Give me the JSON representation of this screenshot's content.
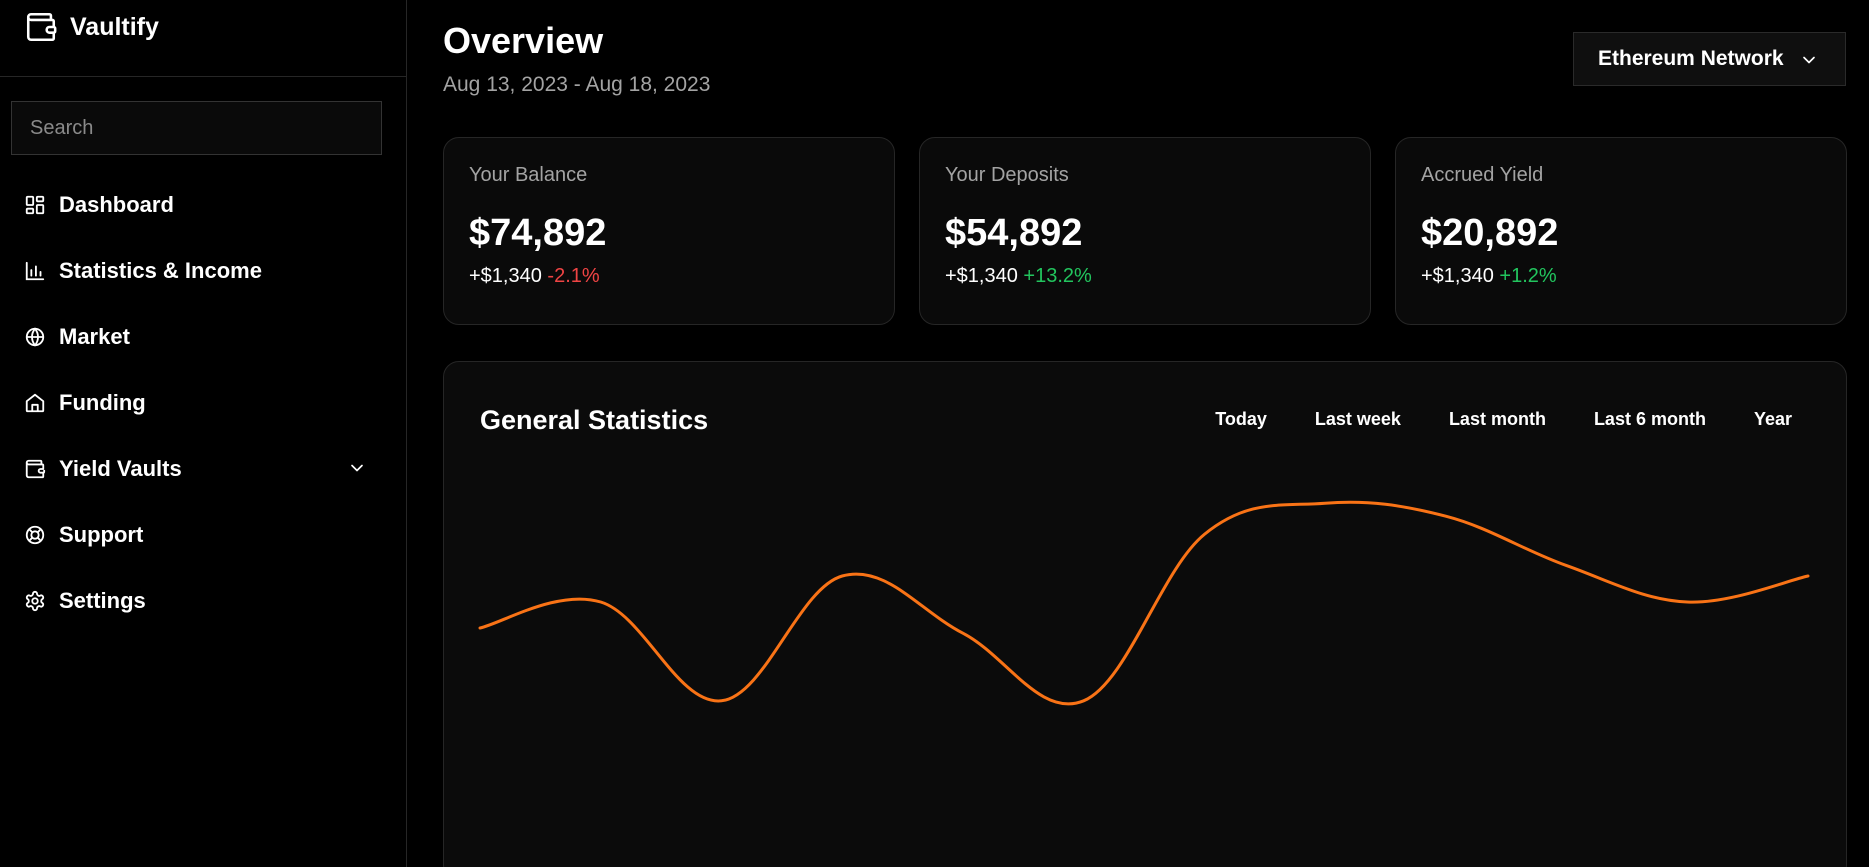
{
  "app": {
    "name": "Vaultify"
  },
  "sidebar": {
    "search_placeholder": "Search",
    "items": [
      {
        "label": "Dashboard",
        "icon": "layout-grid-icon"
      },
      {
        "label": "Statistics & Income",
        "icon": "bar-chart-icon"
      },
      {
        "label": "Market",
        "icon": "globe-icon"
      },
      {
        "label": "Funding",
        "icon": "home-icon"
      },
      {
        "label": "Yield Vaults",
        "icon": "wallet-icon"
      },
      {
        "label": "Support",
        "icon": "life-buoy-icon"
      },
      {
        "label": "Settings",
        "icon": "gear-icon"
      }
    ]
  },
  "header": {
    "title": "Overview",
    "date_range": "Aug 13, 2023 - Aug 18, 2023",
    "network": "Ethereum Network"
  },
  "cards": [
    {
      "label": "Your Balance",
      "value": "$74,892",
      "change": "+$1,340",
      "pct": "-2.1%"
    },
    {
      "label": "Your Deposits",
      "value": "$54,892",
      "change": "+$1,340",
      "pct": "+13.2%"
    },
    {
      "label": "Accrued Yield",
      "value": "$20,892",
      "change": "+$1,340",
      "pct": "+1.2%"
    }
  ],
  "stats": {
    "title": "General Statistics",
    "tabs": [
      "Today",
      "Last week",
      "Last month",
      "Last 6 month",
      "Year"
    ]
  },
  "colors": {
    "accent": "#f97316",
    "negative": "#ef4444",
    "positive": "#22c55e"
  },
  "chart_data": {
    "type": "line",
    "x": [
      0,
      1,
      2,
      3,
      4,
      5,
      6,
      7,
      8,
      9,
      10,
      11
    ],
    "series": [
      {
        "values": [
          40,
          50,
          12,
          60,
          38,
          12,
          76,
          88,
          83,
          64,
          50,
          60
        ]
      }
    ],
    "ylim": [
      0,
      100
    ],
    "grid": false
  }
}
